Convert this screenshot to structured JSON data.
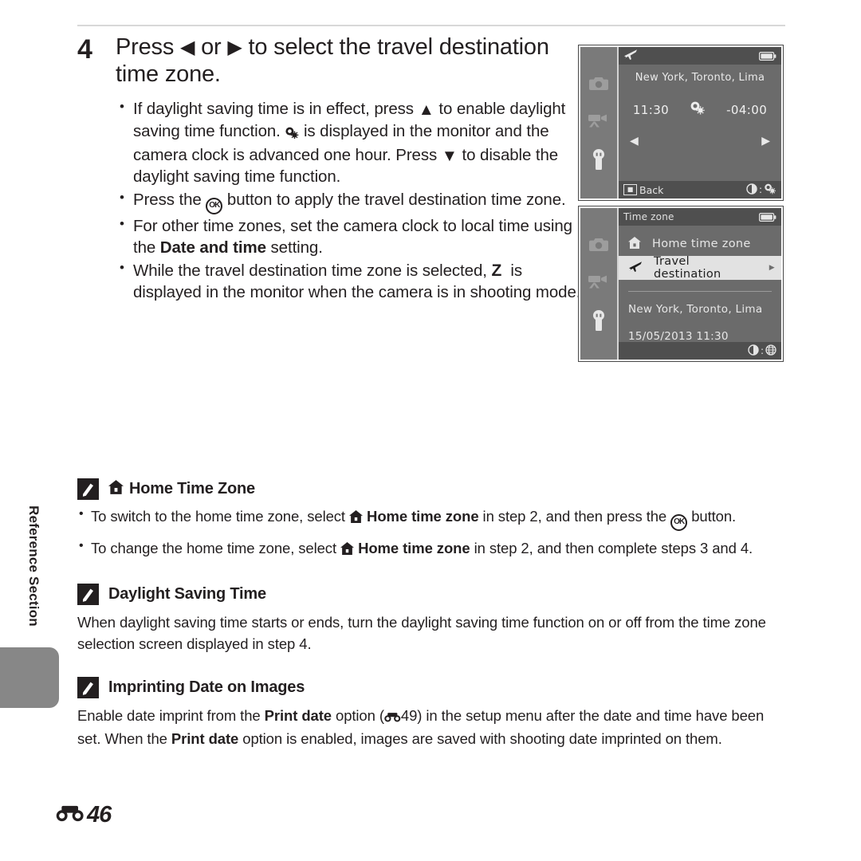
{
  "page": {
    "section_label": "Reference Section",
    "folio_icon": "reference-section-mark",
    "folio_number": "46"
  },
  "step": {
    "number": "4",
    "title_part1": "Press",
    "title_left_glyph": "left-triangle-icon",
    "title_or": "or",
    "title_right_glyph": "right-triangle-icon",
    "title_part2": "to select the travel destination time zone.",
    "bullets": [
      {
        "id": "bullet-dst",
        "segments": [
          {
            "t": "If daylight saving time is in effect, press "
          },
          {
            "icon": "up-triangle-icon"
          },
          {
            "t": " to enable daylight saving time function. "
          },
          {
            "icon": "dst-clock-icon"
          },
          {
            "t": " is displayed in the monitor and the camera clock is advanced one hour. Press "
          },
          {
            "icon": "down-triangle-icon"
          },
          {
            "t": " to disable the daylight saving time function."
          }
        ]
      },
      {
        "id": "bullet-ok",
        "segments": [
          {
            "t": "Press the "
          },
          {
            "icon": "ok-button-icon"
          },
          {
            "t": " button to apply the travel destination time zone."
          }
        ]
      },
      {
        "id": "bullet-other-zones",
        "segments": [
          {
            "t": "For other time zones, set the camera clock to local time using the "
          },
          {
            "b": "Date and time"
          },
          {
            "t": " setting."
          }
        ]
      },
      {
        "id": "bullet-travel-indicator",
        "segments": [
          {
            "t": "While the travel destination time zone is selected, "
          },
          {
            "icon": "travel-z-icon"
          },
          {
            "t": " is displayed in the monitor when the camera is in shooting mode."
          }
        ]
      }
    ]
  },
  "screens": [
    {
      "id": "travel-destination-screen",
      "rail_icons": [
        "camera-icon",
        "movie-camera-icon",
        "wrench-icon"
      ],
      "rail_selected": "wrench-icon",
      "topbar_icon": "airplane-icon",
      "topbar_battery_icon": "battery-icon",
      "city": "New York, Toronto, Lima",
      "time": "11:30",
      "dst_icon": "dst-clock-icon",
      "offset": "-04:00",
      "left_arrow_icon": "left-triangle-icon",
      "right_arrow_icon": "right-triangle-icon",
      "back_key_icon": "menu-key-icon",
      "back_label": "Back",
      "hint_left_icon": "rotary-dial-icon",
      "hint_sep": ":",
      "hint_right_icon": "dst-clock-icon"
    },
    {
      "id": "time-zone-menu-screen",
      "rail_icons": [
        "camera-icon",
        "movie-camera-icon",
        "wrench-icon"
      ],
      "rail_selected": "wrench-icon",
      "title": "Time zone",
      "topbar_battery_icon": "battery-icon",
      "rows": [
        {
          "icon": "home-icon",
          "label": "Home time zone",
          "selected": false,
          "chevron": false
        },
        {
          "icon": "airplane-icon",
          "label": "Travel destination",
          "selected": true,
          "chevron": true
        }
      ],
      "city": "New York, Toronto, Lima",
      "datetime": "15/05/2013   11:30",
      "hint_left_icon": "rotary-dial-icon",
      "hint_sep": ":",
      "hint_right_icon": "globe-icon"
    }
  ],
  "notes": [
    {
      "id": "note-home-time-zone",
      "icon": "pencil-note-icon",
      "title_icon": "home-icon",
      "title": "Home Time Zone",
      "bullets": [
        {
          "segments": [
            {
              "t": "To switch to the home time zone, select "
            },
            {
              "icon": "home-icon"
            },
            {
              "b": " Home time zone"
            },
            {
              "t": " in step 2, and then press the "
            },
            {
              "icon": "ok-button-icon"
            },
            {
              "t": " button."
            }
          ]
        },
        {
          "segments": [
            {
              "t": "To change the home time zone, select "
            },
            {
              "icon": "home-icon"
            },
            {
              "b": " Home time zone"
            },
            {
              "t": " in step 2, and then complete steps 3 and 4."
            }
          ]
        }
      ]
    },
    {
      "id": "note-daylight-saving-time",
      "icon": "pencil-note-icon",
      "title": "Daylight Saving Time",
      "body_segments": [
        {
          "t": "When daylight saving time starts or ends, turn the daylight saving time function on or off from the time zone selection screen displayed in step 4."
        }
      ]
    },
    {
      "id": "note-imprinting-date",
      "icon": "pencil-note-icon",
      "title": "Imprinting Date on Images",
      "body_segments": [
        {
          "t": "Enable date imprint from the "
        },
        {
          "b": "Print date"
        },
        {
          "t": " option ("
        },
        {
          "icon": "reference-section-mark"
        },
        {
          "t": "49) in the setup menu after the date and time have been set. When the "
        },
        {
          "b": "Print date"
        },
        {
          "t": " option is enabled, images are saved with shooting date imprinted on them."
        }
      ]
    }
  ],
  "colors": {
    "text": "#231f20",
    "rule": "#d8d8d8",
    "tab_gray": "#878787",
    "screen_bg": "#6b6b6b",
    "screen_bar": "#4f4f4f",
    "rail_bg": "#7a7a7a",
    "highlight": "#e2e2e2"
  }
}
